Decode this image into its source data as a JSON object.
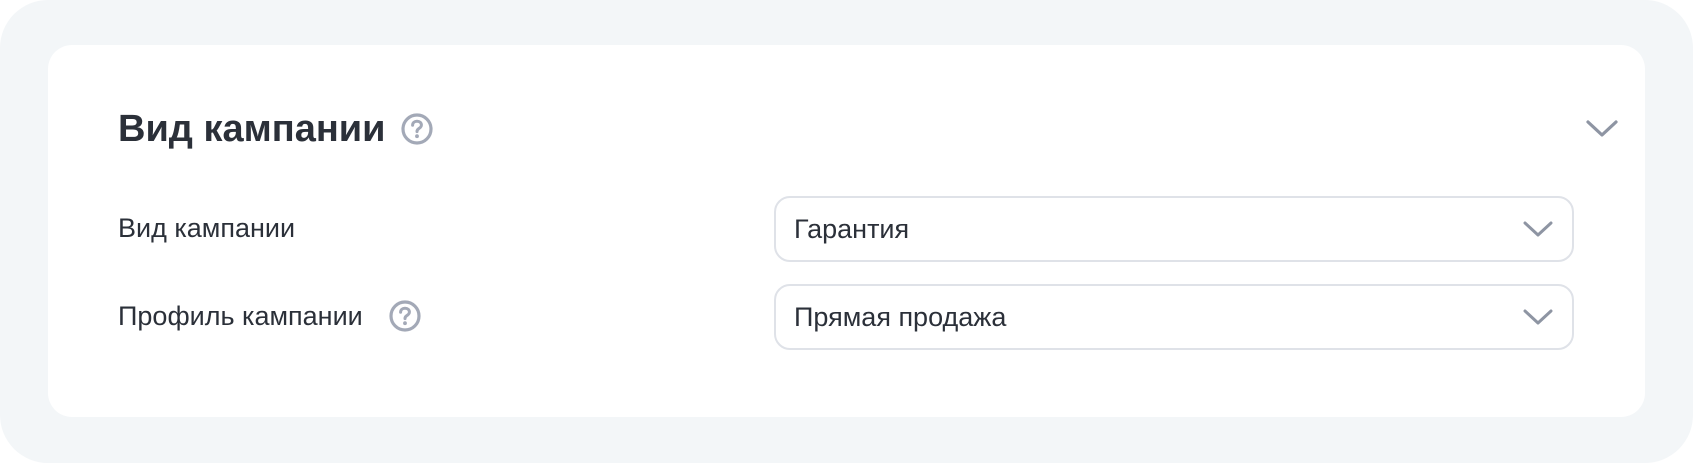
{
  "section": {
    "title": "Вид кампании",
    "help_icon": "question-circle-icon",
    "collapse_icon": "chevron-down-icon"
  },
  "fields": [
    {
      "label": "Вид кампании",
      "value": "Гарантия",
      "has_help": false,
      "dropdown_icon": "chevron-down-icon"
    },
    {
      "label": "Профиль кампании",
      "value": "Прямая продажа",
      "has_help": true,
      "help_icon": "question-circle-icon",
      "dropdown_icon": "chevron-down-icon"
    }
  ],
  "colors": {
    "page_background": "#f3f6f8",
    "card_background": "#ffffff",
    "text": "#2b3039",
    "icon_gray": "#a3a9b7",
    "chevron_gray": "#8e95a3",
    "field_border": "#dfe2e8"
  }
}
